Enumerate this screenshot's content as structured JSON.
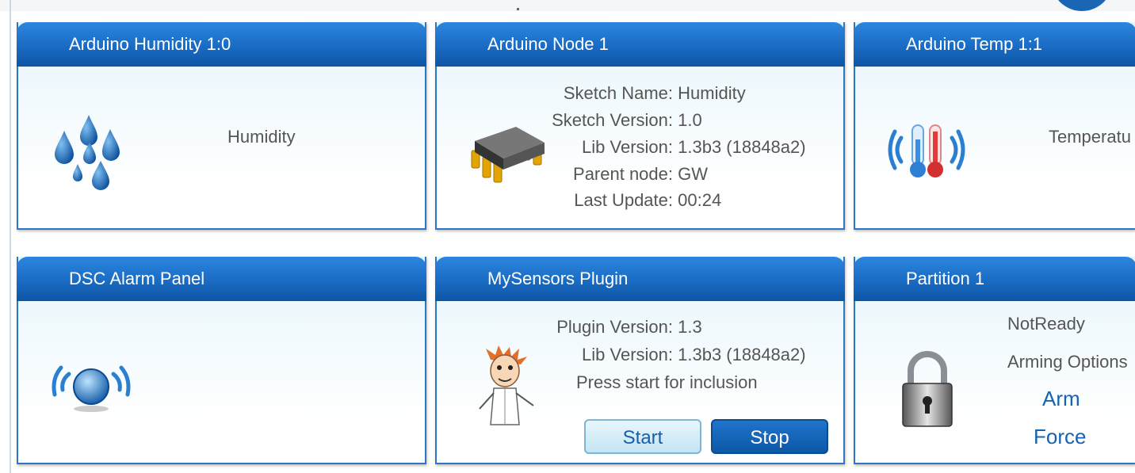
{
  "panels": {
    "humidity_sensor": {
      "title": "Arduino Humidity 1:0",
      "label": "Humidity"
    },
    "node": {
      "title": "Arduino Node 1",
      "sketch_name_label": "Sketch Name:",
      "sketch_name": "Humidity",
      "sketch_version_label": "Sketch Version:",
      "sketch_version": "1.0",
      "lib_version_label": "Lib Version:",
      "lib_version": "1.3b3 (18848a2)",
      "parent_node_label": "Parent node:",
      "parent_node": "GW",
      "last_update_label": "Last Update:",
      "last_update": "00:24"
    },
    "temp_sensor": {
      "title": "Arduino Temp 1:1",
      "label": "Temperatu"
    },
    "dsc_alarm": {
      "title": "DSC Alarm Panel"
    },
    "plugin": {
      "title": "MySensors Plugin",
      "plugin_version_label": "Plugin Version:",
      "plugin_version": "1.3",
      "lib_version_label": "Lib Version:",
      "lib_version": "1.3b3 (18848a2)",
      "message": "Press start for inclusion",
      "start_label": "Start",
      "stop_label": "Stop"
    },
    "partition": {
      "title": "Partition 1",
      "status": "NotReady",
      "arming_label": "Arming Options",
      "arm_label": "Arm",
      "force_label": "Force"
    }
  },
  "icons": {
    "humidity": "water-drops-icon",
    "node": "chip-icon",
    "temp": "thermometer-icon",
    "dsc": "alarm-sensor-icon",
    "plugin": "scientist-icon",
    "partition": "padlock-icon"
  },
  "colors": {
    "header": "#1a6bc3",
    "accent_link": "#1563b5",
    "border": "#2a77c6"
  }
}
